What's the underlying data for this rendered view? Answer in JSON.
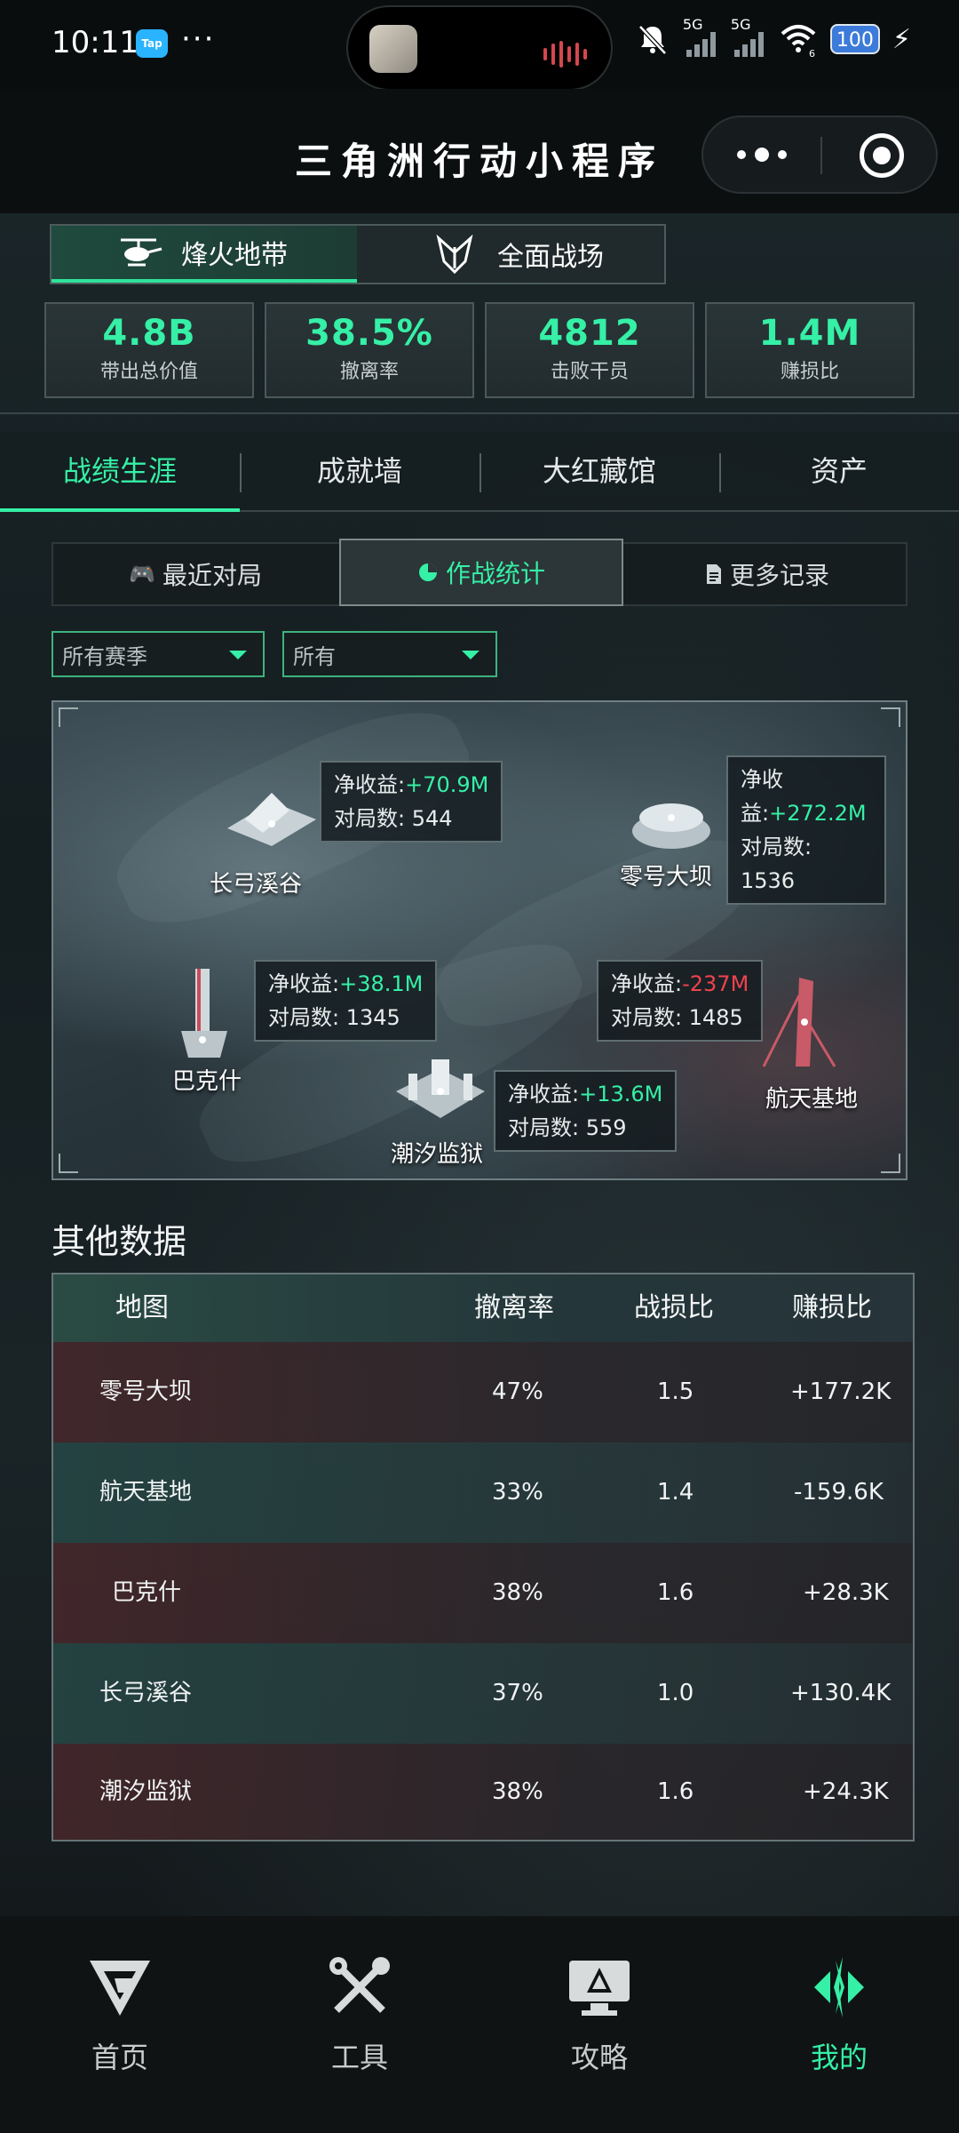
{
  "status_bar": {
    "time": "10:11",
    "app_badge": "Tap",
    "more": "···",
    "network1": "5G",
    "network2": "5G",
    "wifi_level": "6",
    "battery": "100"
  },
  "header": {
    "title": "三角洲行动小程序"
  },
  "mode_tabs": [
    {
      "label": "烽火地带",
      "icon": "helicopter-icon",
      "active": true
    },
    {
      "label": "全面战场",
      "icon": "shield-emblem-icon",
      "active": false
    }
  ],
  "stats": [
    {
      "value": "4.8B",
      "label": "带出总价值"
    },
    {
      "value": "38.5%",
      "label": "撤离率"
    },
    {
      "value": "4812",
      "label": "击败干员"
    },
    {
      "value": "1.4M",
      "label": "赚损比"
    }
  ],
  "section_tabs": [
    {
      "label": "战绩生涯",
      "active": true
    },
    {
      "label": "成就墙"
    },
    {
      "label": "大红藏馆"
    },
    {
      "label": "资产"
    }
  ],
  "sub_tabs": [
    {
      "label": "最近对局",
      "icon": "gamepad-icon"
    },
    {
      "label": "作战统计",
      "icon": "pie-chart-icon",
      "active": true
    },
    {
      "label": "更多记录",
      "icon": "document-icon"
    }
  ],
  "filters": {
    "season": "所有赛季",
    "mode": "所有"
  },
  "map": {
    "net_label": "净收益:",
    "net_label_wrap": "净收",
    "net_label_wrap2": "益:",
    "matches_label": "对局数: ",
    "locations": [
      {
        "name": "长弓溪谷",
        "net": "+70.9M",
        "matches": "544"
      },
      {
        "name": "零号大坝",
        "net": "+272.2M",
        "matches": "1536"
      },
      {
        "name": "巴克什",
        "net": "+38.1M",
        "matches": "1345"
      },
      {
        "name": "航天基地",
        "net": "-237M",
        "matches": "1485"
      },
      {
        "name": "潮汐监狱",
        "net": "+13.6M",
        "matches": "559"
      }
    ]
  },
  "other_data": {
    "title": "其他数据",
    "columns": [
      "地图",
      "撤离率",
      "战损比",
      "赚损比"
    ],
    "rows": [
      [
        "零号大坝",
        "47%",
        "1.5",
        "+177.2K"
      ],
      [
        "航天基地",
        "33%",
        "1.4",
        "-159.6K"
      ],
      [
        "巴克什",
        "38%",
        "1.6",
        "+28.3K"
      ],
      [
        "长弓溪谷",
        "37%",
        "1.0",
        "+130.4K"
      ],
      [
        "潮汐监狱",
        "38%",
        "1.6",
        "+24.3K"
      ]
    ]
  },
  "bottom_nav": [
    {
      "label": "首页",
      "icon": "logo-v-icon"
    },
    {
      "label": "工具",
      "icon": "tools-icon"
    },
    {
      "label": "攻略",
      "icon": "monitor-icon"
    },
    {
      "label": "我的",
      "icon": "profile-emblem-icon",
      "active": true
    }
  ],
  "colors": {
    "accent": "#35f0a6",
    "negative": "#f0434c",
    "background": "#121a1c"
  }
}
